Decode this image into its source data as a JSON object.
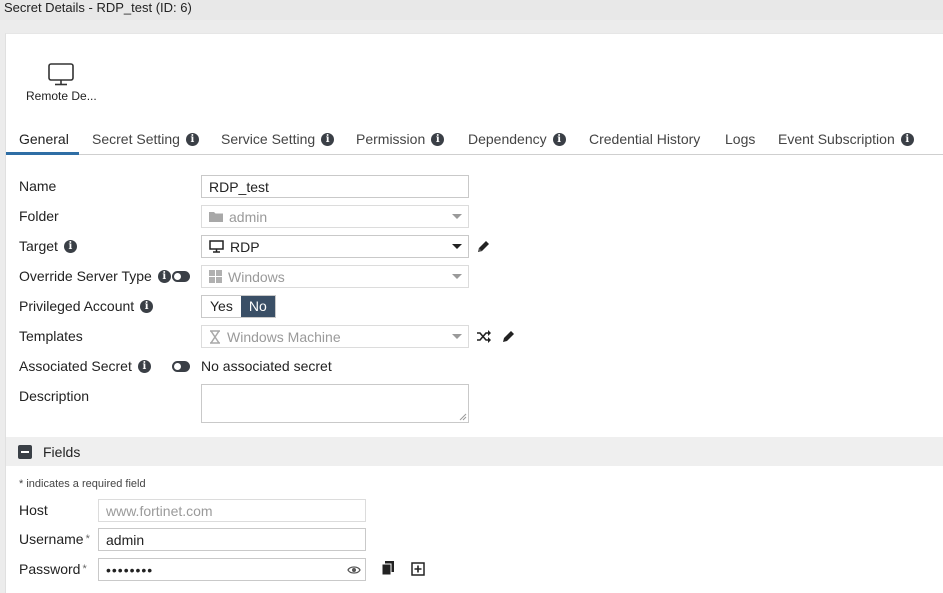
{
  "window": {
    "title": "Secret Details - RDP_test (ID: 6)"
  },
  "secret_type": {
    "label": "Remote De...",
    "icon": "monitor-icon"
  },
  "tabs": [
    {
      "label": "General",
      "info": false,
      "active": true
    },
    {
      "label": "Secret Setting",
      "info": true
    },
    {
      "label": "Service Setting",
      "info": true
    },
    {
      "label": "Permission",
      "info": true
    },
    {
      "label": "Dependency",
      "info": true
    },
    {
      "label": "Credential History",
      "info": false
    },
    {
      "label": "Logs",
      "info": false
    },
    {
      "label": "Event Subscription",
      "info": true
    }
  ],
  "form": {
    "name": {
      "label": "Name",
      "value": "RDP_test"
    },
    "folder": {
      "label": "Folder",
      "value": "admin"
    },
    "target": {
      "label": "Target",
      "value": "RDP"
    },
    "override_server_type": {
      "label": "Override Server Type",
      "value": "Windows",
      "toggle": "off"
    },
    "privileged_account": {
      "label": "Privileged Account",
      "options": [
        "Yes",
        "No"
      ],
      "selected": "No"
    },
    "templates": {
      "label": "Templates",
      "value": "Windows Machine"
    },
    "associated_secret": {
      "label": "Associated Secret",
      "value": "No associated secret",
      "toggle": "off"
    },
    "description": {
      "label": "Description",
      "value": ""
    }
  },
  "fields_section": {
    "title": "Fields",
    "required_note": "* indicates a required field",
    "host": {
      "label": "Host",
      "placeholder": "www.fortinet.com",
      "value": ""
    },
    "username": {
      "label": "Username",
      "required_mark": "*",
      "value": "admin"
    },
    "password": {
      "label": "Password",
      "required_mark": "*",
      "masked": "••••••••"
    }
  },
  "colors": {
    "accent": "#2f6ea5",
    "selected_segment": "#3a4f66",
    "icon_dark": "#3a3f46"
  }
}
